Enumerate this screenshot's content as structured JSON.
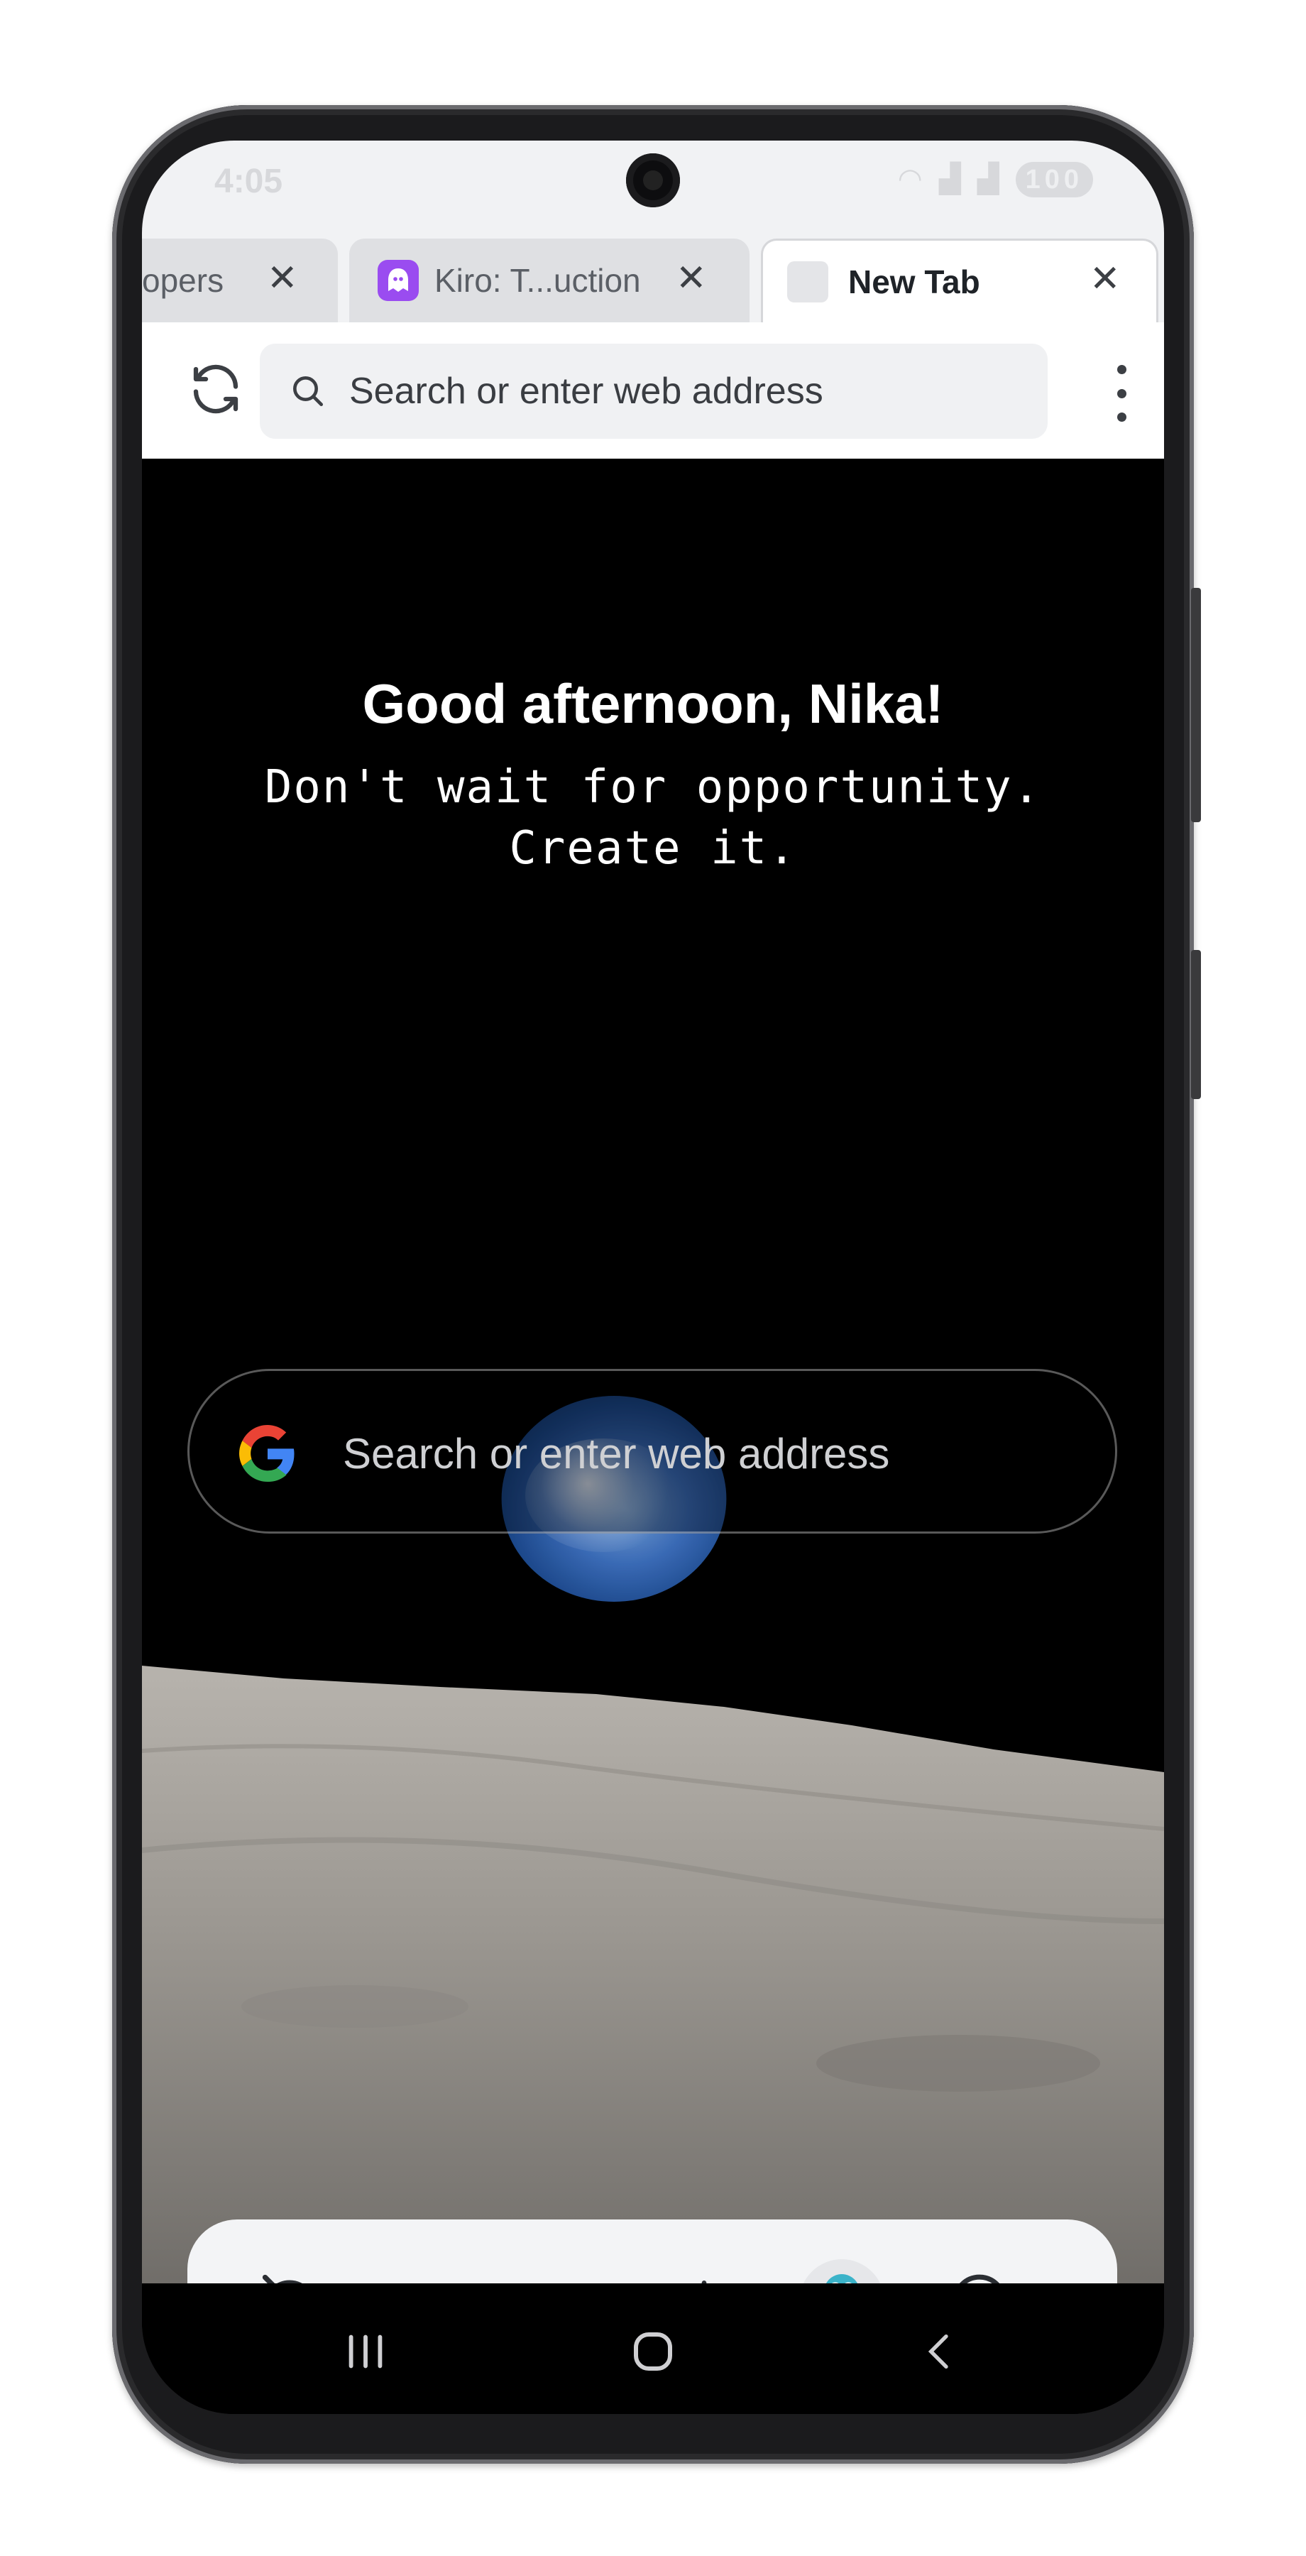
{
  "status_bar": {
    "time": "4:05",
    "battery": "100"
  },
  "tabs": [
    {
      "label": "opers",
      "close": "✕"
    },
    {
      "label": "Kiro: T...uction",
      "close": "✕"
    },
    {
      "label": "New Tab",
      "close": "✕",
      "active": true
    }
  ],
  "toolbar": {
    "search_placeholder": "Search or enter web address"
  },
  "new_tab": {
    "greeting": "Good afternoon, Nika!",
    "quote_line1": "Don't wait for opportunity.",
    "quote_line2": "Create it.",
    "search_placeholder": "Search or enter web address"
  },
  "bottom_bar": {
    "items": [
      "incognito-eye-off",
      "back",
      "forward",
      "new-tab-plus",
      "assistant-spider",
      "account"
    ]
  },
  "colors": {
    "kiro_favicon": "#9a4cf0",
    "toolbar_bg": "#ffffff",
    "content_bg": "#000000"
  }
}
